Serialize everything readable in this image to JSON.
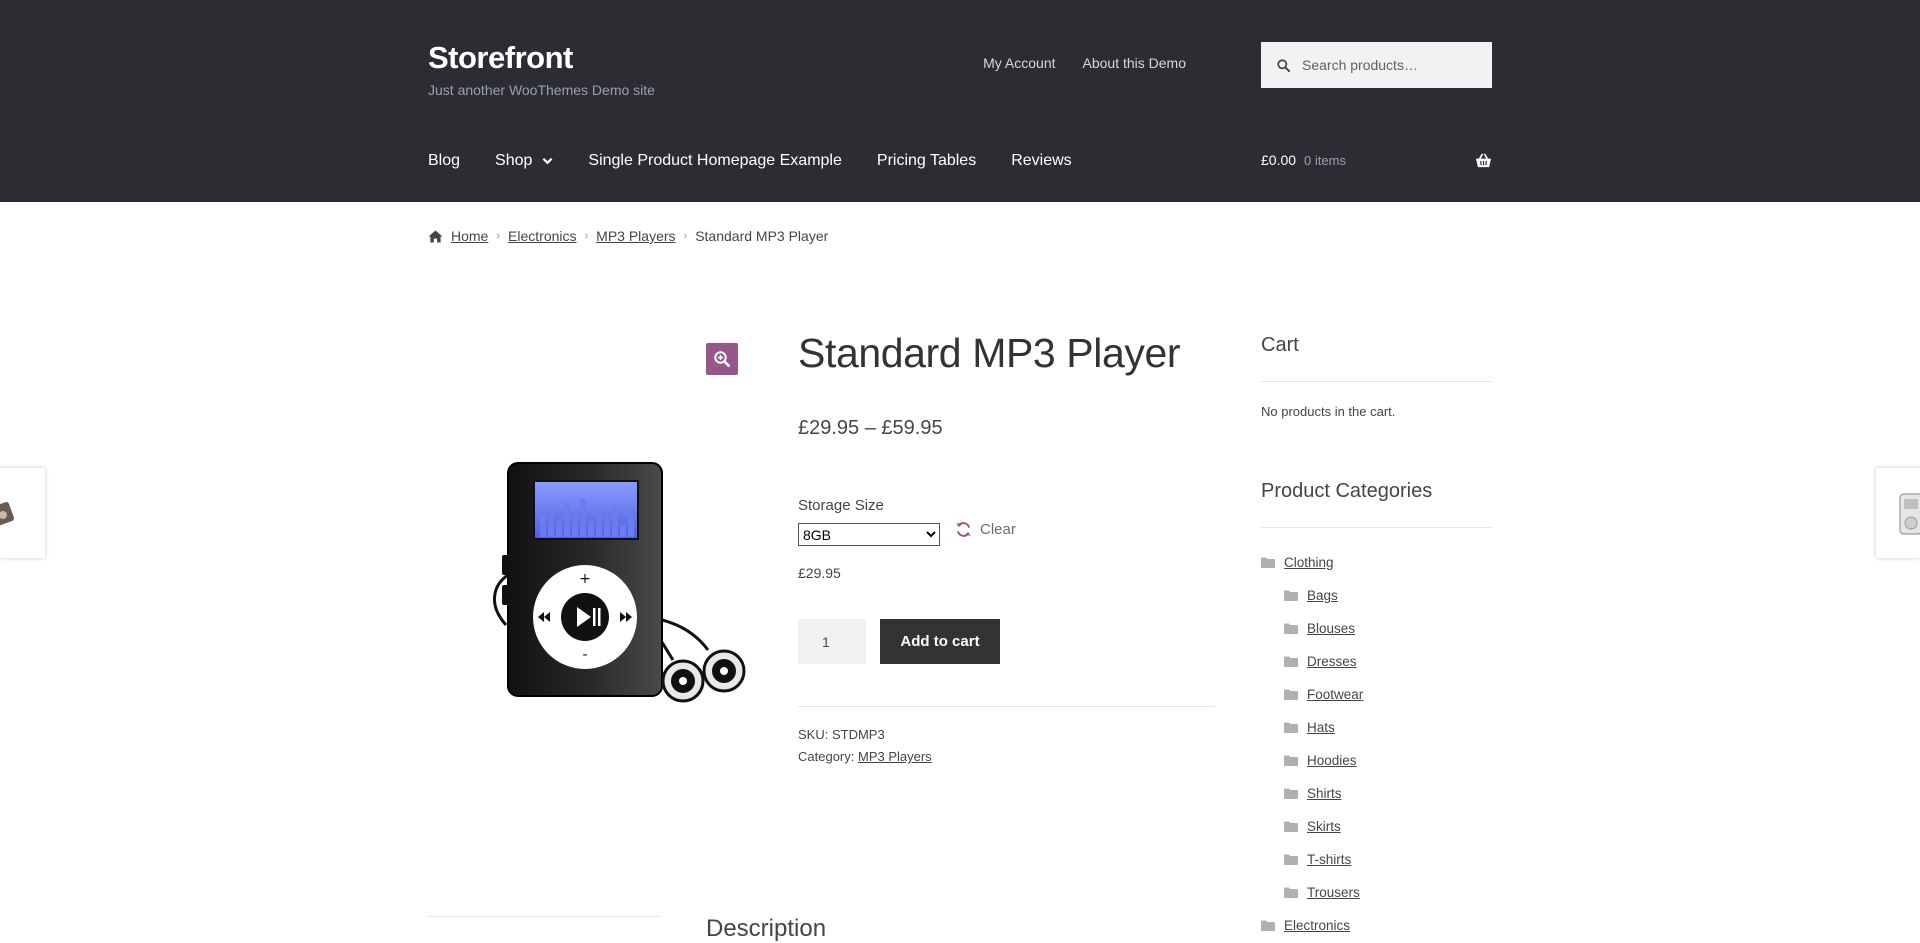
{
  "site": {
    "title": "Storefront",
    "tagline": "Just another WooThemes Demo site"
  },
  "secondary_nav": [
    {
      "label": "My Account"
    },
    {
      "label": "About this Demo"
    }
  ],
  "search": {
    "placeholder": "Search products…"
  },
  "primary_nav": [
    {
      "label": "Blog"
    },
    {
      "label": "Shop"
    },
    {
      "label": "Single Product Homepage Example"
    },
    {
      "label": "Pricing Tables"
    },
    {
      "label": "Reviews"
    }
  ],
  "header_cart": {
    "amount": "£0.00",
    "count": "0 items"
  },
  "breadcrumb": {
    "items": [
      "Home",
      "Electronics",
      "MP3 Players"
    ],
    "current": "Standard MP3 Player"
  },
  "product": {
    "title": "Standard MP3 Player",
    "price_range": "£29.95 – £59.95",
    "variation_label": "Storage Size",
    "variation_selected": "8GB",
    "reset_label": "Clear",
    "variation_price": "£29.95",
    "quantity": "1",
    "add_to_cart_label": "Add to cart",
    "sku": "SKU: STDMP3",
    "category_prefix": "Category: ",
    "category": "MP3 Players"
  },
  "sidebar": {
    "cart_title": "Cart",
    "cart_empty": "No products in the cart.",
    "categories_title": "Product Categories",
    "categories": {
      "clothing": "Clothing",
      "children": [
        "Bags",
        "Blouses",
        "Dresses",
        "Footwear",
        "Hats",
        "Hoodies",
        "Shirts",
        "Skirts",
        "T-shirts",
        "Trousers"
      ],
      "electronics": "Electronics"
    }
  },
  "description_title": "Description",
  "colors": {
    "header_bg": "#2c2d33",
    "accent": "#96588a",
    "button_bg": "#333333",
    "text": "#43454b"
  },
  "icons": [
    "search-icon",
    "chevron-down-icon",
    "basket-icon",
    "home-icon",
    "zoom-in-icon",
    "refresh-icon",
    "folder-icon"
  ]
}
